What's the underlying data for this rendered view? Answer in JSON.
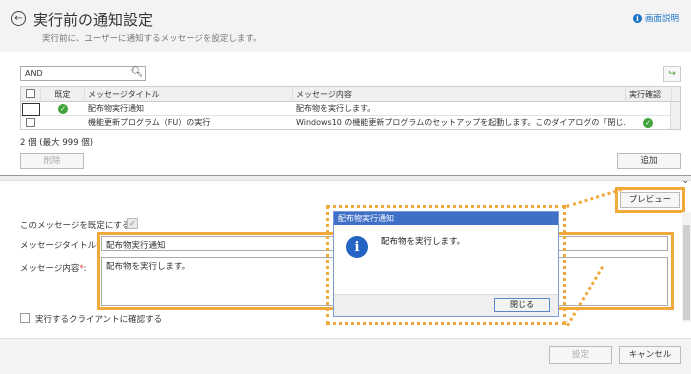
{
  "header": {
    "title": "実行前の通知設定",
    "subtitle": "実行前に、ユーザーに通知するメッセージを設定します。",
    "help_label": "画面説明"
  },
  "search": {
    "value": "AND",
    "icon": "search-icon"
  },
  "table": {
    "columns": [
      "既定",
      "メッセージタイトル",
      "メッセージ内容",
      "実行確認"
    ],
    "rows": [
      {
        "default": true,
        "title": "配布物実行通知",
        "content": "配布物を実行します。",
        "confirm": false
      },
      {
        "default": false,
        "title": "機能更新プログラム（FU）の実行",
        "content": "Windows10 の機能更新プログラムのセットアップを起動します。このダイアログの「閉じ…",
        "confirm": true
      }
    ]
  },
  "count_label": "2 個 (最大 999 個)",
  "buttons": {
    "delete": "削除",
    "add": "追加",
    "preview": "プレビュー",
    "settings": "設定",
    "cancel": "キャンセル"
  },
  "form": {
    "default_label": "このメッセージを既定にする：",
    "title_label": "メッセージタイトル",
    "title_value": "配布物実行通知",
    "content_label": "メッセージ内容",
    "content_value": "配布物を実行します。",
    "required_mark": "*",
    "colon": ":",
    "confirm_label": "実行するクライアントに確認する",
    "default_checked": true,
    "confirm_checked": false
  },
  "dialog": {
    "title": "配布物実行通知",
    "message": "配布物を実行します。",
    "close_label": "閉じる"
  },
  "colors": {
    "highlight": "#f2a93b",
    "accent": "#1a73c8",
    "dialog_title": "#3f6fc6",
    "check": "#41a33a"
  }
}
